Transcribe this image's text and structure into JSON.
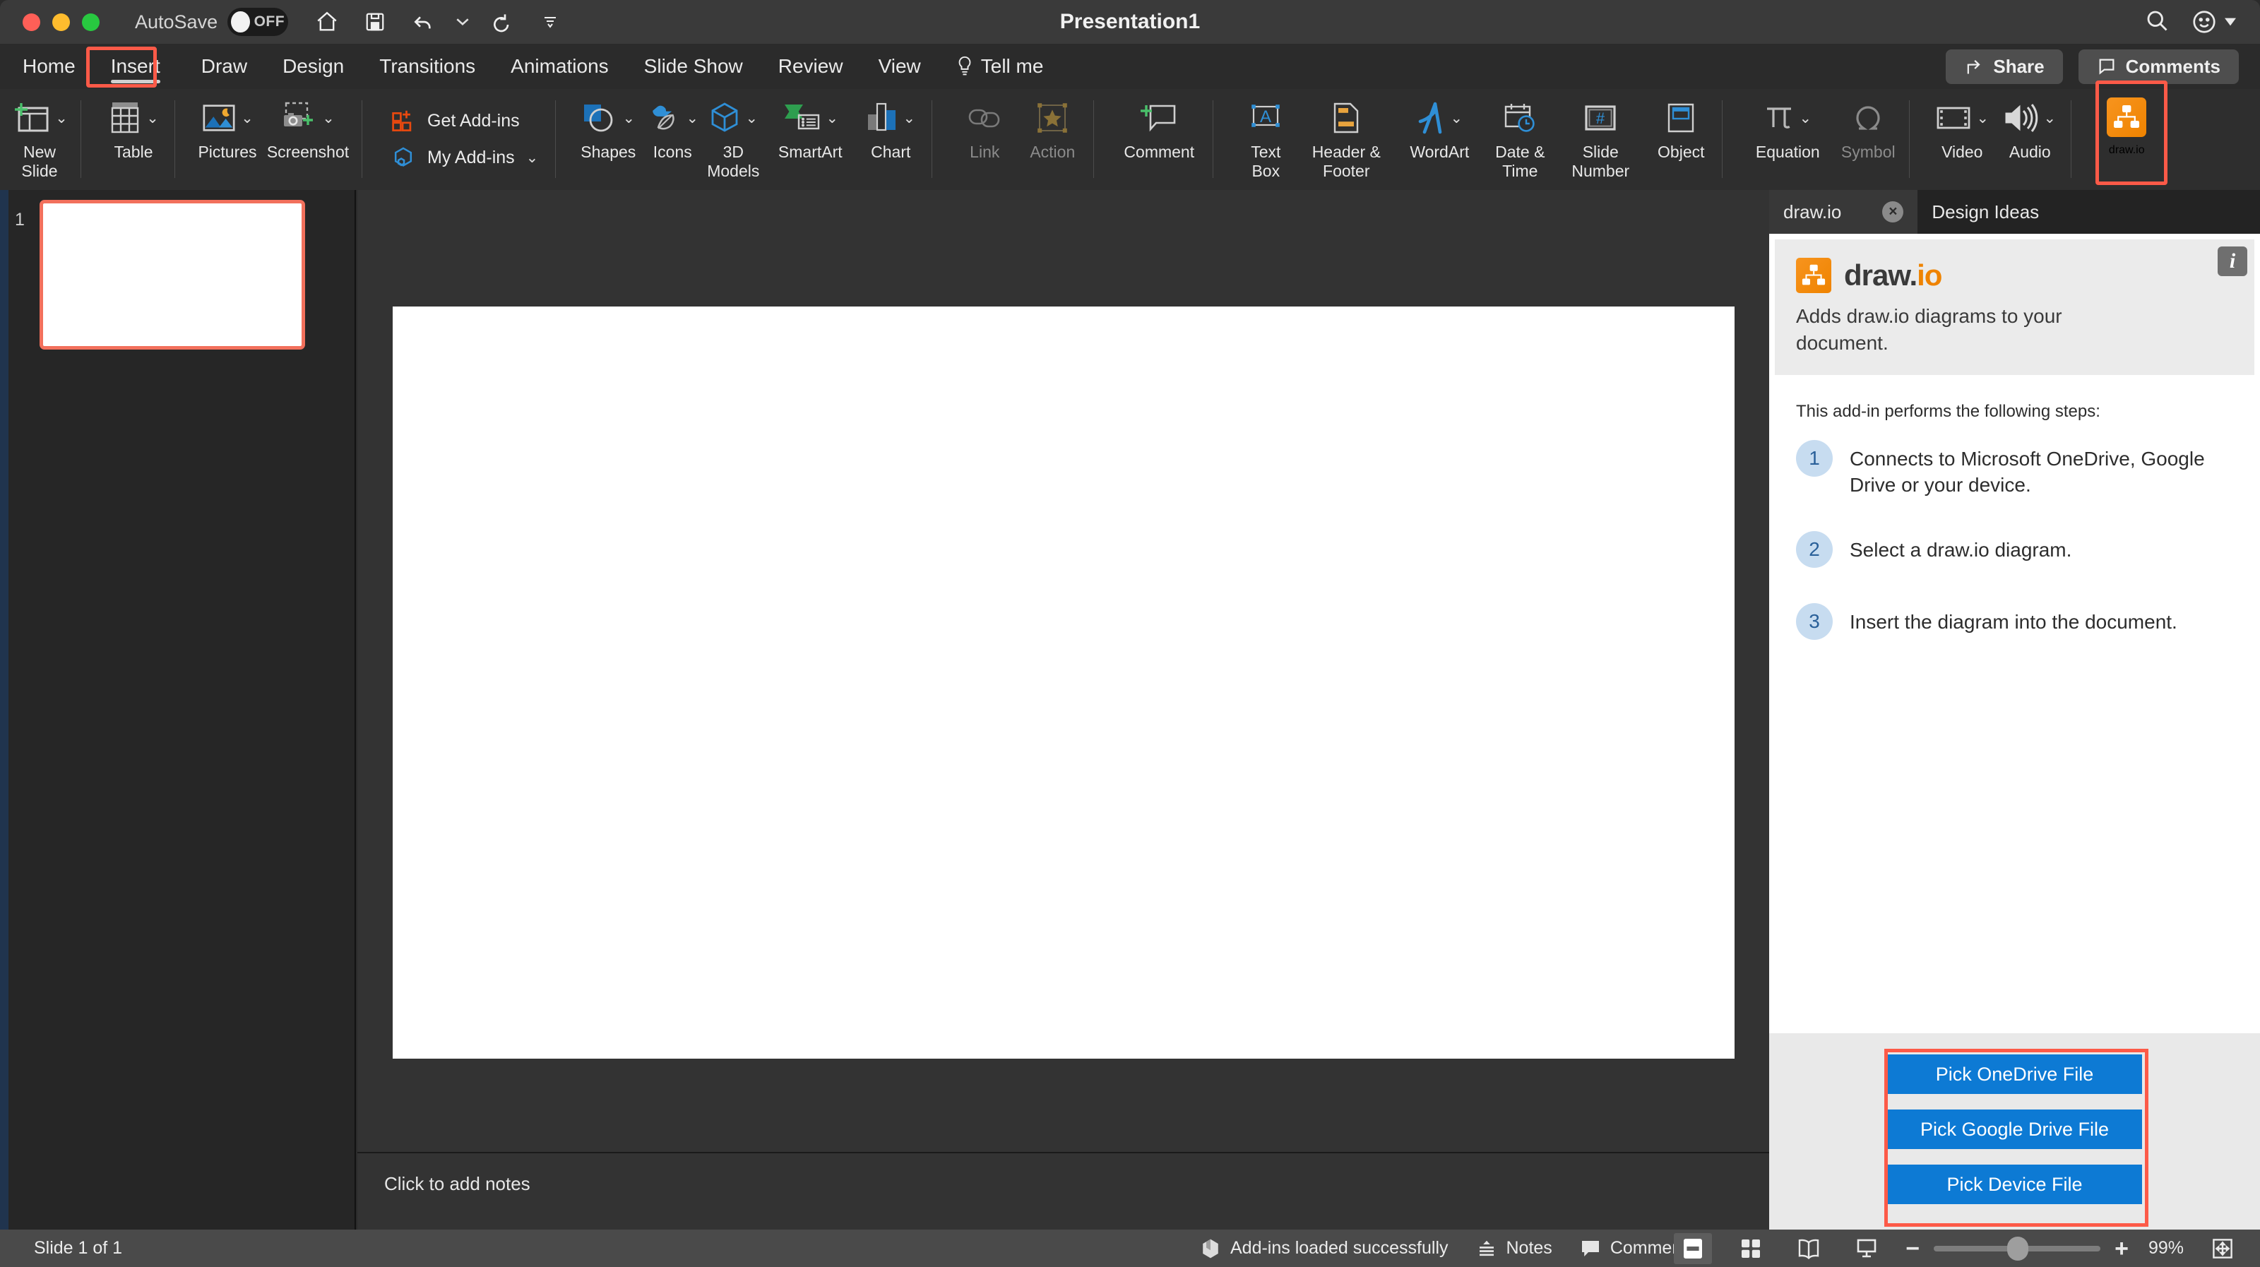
{
  "titlebar": {
    "autosave_label": "AutoSave",
    "autosave_state": "OFF",
    "document_title": "Presentation1",
    "quick_access": [
      "home-icon",
      "save-icon",
      "undo-icon",
      "undo-caret",
      "redo-icon",
      "customize-caret"
    ],
    "search_icon": "search-icon",
    "account_icon": "smiley-face-icon"
  },
  "ribbon_tabs": {
    "items": [
      {
        "label": "Home",
        "active": false
      },
      {
        "label": "Insert",
        "active": true,
        "highlighted": true
      },
      {
        "label": "Draw",
        "active": false
      },
      {
        "label": "Design",
        "active": false
      },
      {
        "label": "Transitions",
        "active": false
      },
      {
        "label": "Animations",
        "active": false
      },
      {
        "label": "Slide Show",
        "active": false
      },
      {
        "label": "Review",
        "active": false
      },
      {
        "label": "View",
        "active": false
      },
      {
        "label": "Tell me",
        "active": false,
        "icon": "lightbulb-icon"
      }
    ],
    "share_label": "Share",
    "comments_label": "Comments"
  },
  "ribbon": {
    "groups": [
      {
        "items": [
          {
            "label": "New\nSlide",
            "icon": "new-slide-icon",
            "caret": true,
            "enabled": true
          }
        ]
      },
      {
        "items": [
          {
            "label": "Table",
            "icon": "table-icon",
            "caret": true,
            "enabled": true
          }
        ]
      },
      {
        "items": [
          {
            "label": "Pictures",
            "icon": "pictures-icon",
            "caret": true,
            "enabled": true
          },
          {
            "label": "Screenshot",
            "icon": "screenshot-icon",
            "caret": true,
            "enabled": true
          }
        ]
      },
      {
        "addins": [
          {
            "label": "Get Add-ins",
            "icon": "get-addins-icon",
            "caret": false
          },
          {
            "label": "My Add-ins",
            "icon": "my-addins-icon",
            "caret": true
          }
        ]
      },
      {
        "items": [
          {
            "label": "Shapes",
            "icon": "shapes-icon",
            "caret": true,
            "enabled": true
          },
          {
            "label": "Icons",
            "icon": "icons-icon",
            "caret": true,
            "enabled": true
          },
          {
            "label": "3D\nModels",
            "icon": "3d-models-icon",
            "caret": true,
            "enabled": true
          },
          {
            "label": "SmartArt",
            "icon": "smartart-icon",
            "caret": true,
            "enabled": true
          },
          {
            "label": "Chart",
            "icon": "chart-icon",
            "caret": true,
            "enabled": true
          }
        ]
      },
      {
        "items": [
          {
            "label": "Link",
            "icon": "link-icon",
            "caret": false,
            "enabled": false
          },
          {
            "label": "Action",
            "icon": "action-icon",
            "caret": false,
            "enabled": false
          }
        ]
      },
      {
        "items": [
          {
            "label": "Comment",
            "icon": "comment-icon",
            "caret": false,
            "enabled": true
          }
        ]
      },
      {
        "items": [
          {
            "label": "Text\nBox",
            "icon": "text-box-icon",
            "caret": false,
            "enabled": true
          },
          {
            "label": "Header &\nFooter",
            "icon": "header-footer-icon",
            "caret": false,
            "enabled": true
          },
          {
            "label": "WordArt",
            "icon": "wordart-icon",
            "caret": true,
            "enabled": true
          },
          {
            "label": "Date &\nTime",
            "icon": "date-time-icon",
            "caret": false,
            "enabled": true
          },
          {
            "label": "Slide\nNumber",
            "icon": "slide-number-icon",
            "caret": false,
            "enabled": true
          },
          {
            "label": "Object",
            "icon": "object-icon",
            "caret": false,
            "enabled": true
          }
        ]
      },
      {
        "items": [
          {
            "label": "Equation",
            "icon": "equation-icon",
            "caret": true,
            "enabled": true
          },
          {
            "label": "Symbol",
            "icon": "symbol-icon",
            "caret": false,
            "enabled": false
          }
        ]
      },
      {
        "items": [
          {
            "label": "Video",
            "icon": "video-icon",
            "caret": true,
            "enabled": true
          },
          {
            "label": "Audio",
            "icon": "audio-icon",
            "caret": true,
            "enabled": true
          }
        ]
      },
      {
        "items": [
          {
            "label": "draw.io",
            "icon": "drawio-icon",
            "caret": false,
            "enabled": true,
            "highlighted": true
          }
        ]
      }
    ]
  },
  "thumbnails": {
    "slides": [
      {
        "number": "1",
        "selected": true
      }
    ]
  },
  "stage": {
    "notes_placeholder": "Click to add notes"
  },
  "task_pane": {
    "tabs": [
      {
        "label": "draw.io",
        "active": true,
        "closable": true
      },
      {
        "label": "Design Ideas",
        "active": false,
        "closable": false
      }
    ],
    "close_glyph": "×",
    "info_glyph": "i",
    "brand_name": "draw.",
    "brand_suffix": "io",
    "description": "Adds draw.io diagrams to your document.",
    "steps_intro": "This add-in performs the following steps:",
    "steps": [
      {
        "num": "1",
        "text": "Connects to Microsoft OneDrive, Google Drive or your device."
      },
      {
        "num": "2",
        "text": "Select a draw.io diagram."
      },
      {
        "num": "3",
        "text": "Insert the diagram into the document."
      }
    ],
    "buttons": [
      {
        "label": "Pick OneDrive File"
      },
      {
        "label": "Pick Google Drive File"
      },
      {
        "label": "Pick Device File"
      }
    ],
    "buttons_highlighted": true
  },
  "statusbar": {
    "slide_count": "Slide 1 of 1",
    "addin_status": "Add-ins loaded successfully",
    "notes_label": "Notes",
    "comments_label": "Comments",
    "view_buttons": [
      "normal-view-icon",
      "slide-sorter-icon",
      "reading-view-icon",
      "slideshow-icon"
    ],
    "zoom_out_glyph": "−",
    "zoom_in_glyph": "+",
    "zoom_level": "99%",
    "fit_icon": "fit-slide-icon"
  },
  "colors": {
    "accent_red": "#fc5a48",
    "drawio_orange": "#ef8300",
    "button_blue": "#0d7ad4",
    "step_badge": "#c7dcf0",
    "ribbon_bg": "#2e2e2e"
  }
}
